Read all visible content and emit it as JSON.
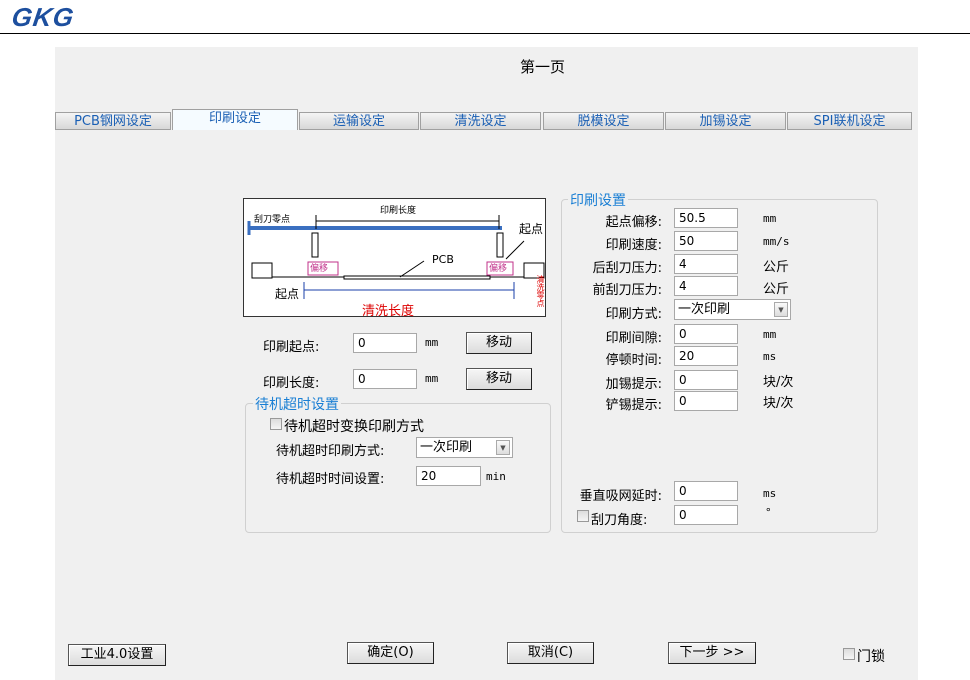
{
  "header": {
    "logo": "GKG"
  },
  "page_title": "第一页",
  "tabs": [
    {
      "label": "PCB钢网设定"
    },
    {
      "label": "印刷设定",
      "active": true
    },
    {
      "label": "运输设定"
    },
    {
      "label": "清洗设定"
    },
    {
      "label": "脱模设定"
    },
    {
      "label": "加锡设定"
    },
    {
      "label": "SPI联机设定"
    }
  ],
  "diagram": {
    "print_length": "印刷长度",
    "squeegee_zero": "刮刀零点",
    "start_top": "起点",
    "offset_left": "偏移",
    "offset_right": "偏移",
    "pcb": "PCB",
    "start_bottom": "起点",
    "clean_length": "清洗长度",
    "clean_zero": "清洗零点"
  },
  "left": {
    "print_start": {
      "label": "印刷起点:",
      "value": "0",
      "unit": "mm",
      "button": "移动"
    },
    "print_length": {
      "label": "印刷长度:",
      "value": "0",
      "unit": "mm",
      "button": "移动"
    }
  },
  "standby": {
    "legend": "待机超时设置",
    "checkbox": "待机超时变换印刷方式",
    "checked": false,
    "mode_label": "待机超时印刷方式:",
    "mode_value": "一次印刷",
    "time_label": "待机超时时间设置:",
    "time_value": "20",
    "time_unit": "min"
  },
  "print_settings": {
    "legend": "印刷设置",
    "rows": [
      {
        "label": "起点偏移:",
        "value": "50.5",
        "unit": "mm"
      },
      {
        "label": "印刷速度:",
        "value": "50",
        "unit": "mm/s"
      },
      {
        "label": "后刮刀压力:",
        "value": "4",
        "unit": "公斤"
      },
      {
        "label": "前刮刀压力:",
        "value": "4",
        "unit": "公斤"
      },
      {
        "label": "印刷方式:",
        "value": "一次印刷"
      },
      {
        "label": "印刷间隙:",
        "value": "0",
        "unit": "mm"
      },
      {
        "label": "停顿时间:",
        "value": "20",
        "unit": "ms"
      },
      {
        "label": "加锡提示:",
        "value": "0",
        "unit": "块/次"
      },
      {
        "label": "铲锡提示:",
        "value": "0",
        "unit": "块/次"
      }
    ],
    "vacuum_delay": {
      "label": "垂直吸网延时:",
      "value": "0",
      "unit": "ms"
    },
    "squeegee_angle": {
      "label": "刮刀角度:",
      "value": "0",
      "unit": "°",
      "checked": false
    }
  },
  "footer": {
    "industry": "工业4.0设置",
    "ok": "确定(O)",
    "cancel": "取消(C)",
    "next": "下一步 >>",
    "door_lock": "门锁",
    "door_lock_checked": false
  }
}
